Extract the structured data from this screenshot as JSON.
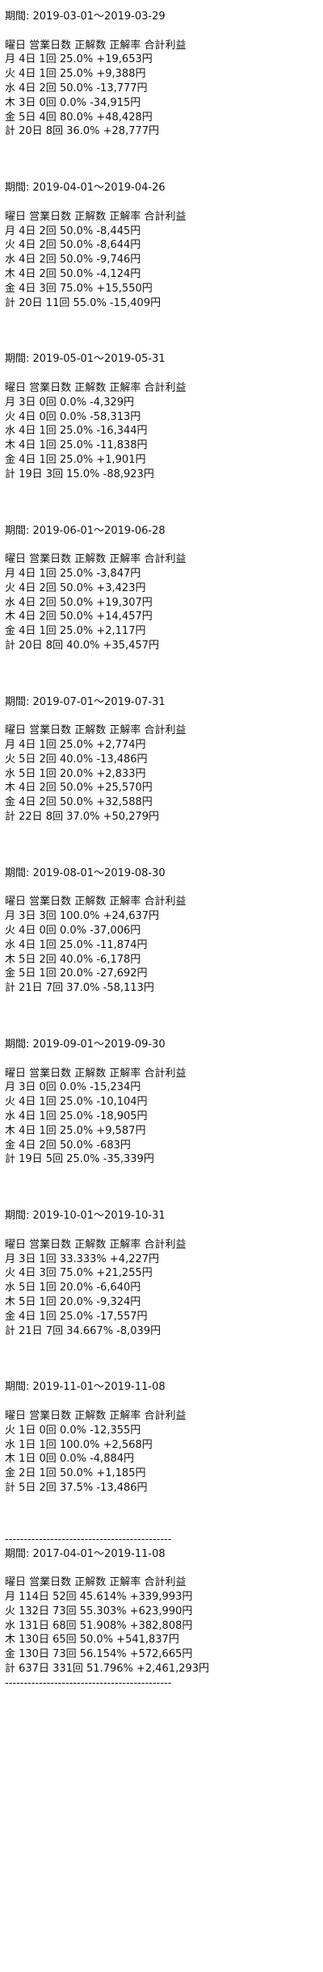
{
  "header_label": "曜日 営業日数 正解数 正解率 合計利益",
  "divider": "--------------------------------------------",
  "summary_divider": "--------------------------------------------",
  "blocks": [
    {
      "period": "期間: 2019-03-01～2019-03-29",
      "rows": [
        "月 4日 1回 25.0% +19,653円",
        "火 4日 1回 25.0% +9,388円",
        "水 4日 2回 50.0% -13,777円",
        "木 3日 0回 0.0% -34,915円",
        "金 5日 4回 80.0% +48,428円",
        "計 20日 8回 36.0% +28,777円"
      ]
    },
    {
      "period": "期間: 2019-04-01～2019-04-26",
      "rows": [
        "月 4日 2回 50.0% -8,445円",
        "火 4日 2回 50.0% -8,644円",
        "水 4日 2回 50.0% -9,746円",
        "木 4日 2回 50.0% -4,124円",
        "金 4日 3回 75.0% +15,550円",
        "計 20日 11回 55.0% -15,409円"
      ]
    },
    {
      "period": "期間: 2019-05-01～2019-05-31",
      "rows": [
        "月 3日 0回 0.0% -4,329円",
        "火 4日 0回 0.0% -58,313円",
        "水 4日 1回 25.0% -16,344円",
        "木 4日 1回 25.0% -11,838円",
        "金 4日 1回 25.0% +1,901円",
        "計 19日 3回 15.0% -88,923円"
      ]
    },
    {
      "period": "期間: 2019-06-01～2019-06-28",
      "rows": [
        "月 4日 1回 25.0% -3,847円",
        "火 4日 2回 50.0% +3,423円",
        "水 4日 2回 50.0% +19,307円",
        "木 4日 2回 50.0% +14,457円",
        "金 4日 1回 25.0% +2,117円",
        "計 20日 8回 40.0% +35,457円"
      ]
    },
    {
      "period": "期間: 2019-07-01～2019-07-31",
      "rows": [
        "月 4日 1回 25.0% +2,774円",
        "火 5日 2回 40.0% -13,486円",
        "水 5日 1回 20.0% +2,833円",
        "木 4日 2回 50.0% +25,570円",
        "金 4日 2回 50.0% +32,588円",
        "計 22日 8回 37.0% +50,279円"
      ]
    },
    {
      "period": "期間: 2019-08-01～2019-08-30",
      "rows": [
        "月 3日 3回 100.0% +24,637円",
        "火 4日 0回 0.0% -37,006円",
        "水 4日 1回 25.0% -11,874円",
        "木 5日 2回 40.0% -6,178円",
        "金 5日 1回 20.0% -27,692円",
        "計 21日 7回 37.0% -58,113円"
      ]
    },
    {
      "period": "期間: 2019-09-01～2019-09-30",
      "rows": [
        "月 3日 0回 0.0% -15,234円",
        "火 4日 1回 25.0% -10,104円",
        "水 4日 1回 25.0% -18,905円",
        "木 4日 1回 25.0% +9,587円",
        "金 4日 2回 50.0% -683円",
        "計 19日 5回 25.0% -35,339円"
      ]
    },
    {
      "period": "期間: 2019-10-01～2019-10-31",
      "rows": [
        "月 3日 1回 33.333% +4,227円",
        "火 4日 3回 75.0% +21,255円",
        "水 5日 1回 20.0% -6,640円",
        "木 5日 1回 20.0% -9,324円",
        "金 4日 1回 25.0% -17,557円",
        "計 21日 7回 34.667% -8,039円"
      ]
    },
    {
      "period": "期間: 2019-11-01～2019-11-08",
      "rows": [
        "火 1日 0回 0.0% -12,355円",
        "水 1日 1回 100.0% +2,568円",
        "木 1日 0回 0.0% -4,884円",
        "金 2日 1回 50.0% +1,185円",
        "計 5日 2回 37.5% -13,486円"
      ]
    }
  ],
  "summary": {
    "period": "期間: 2017-04-01～2019-11-08",
    "rows": [
      "月 114日 52回 45.614% +339,993円",
      "火 132日 73回 55.303% +623,990円",
      "水 131日 68回 51.908% +382,808円",
      "木 130日 65回 50.0% +541,837円",
      "金 130日 73回 56.154% +572,665円",
      "計 637日 331回 51.796% +2,461,293円"
    ]
  }
}
